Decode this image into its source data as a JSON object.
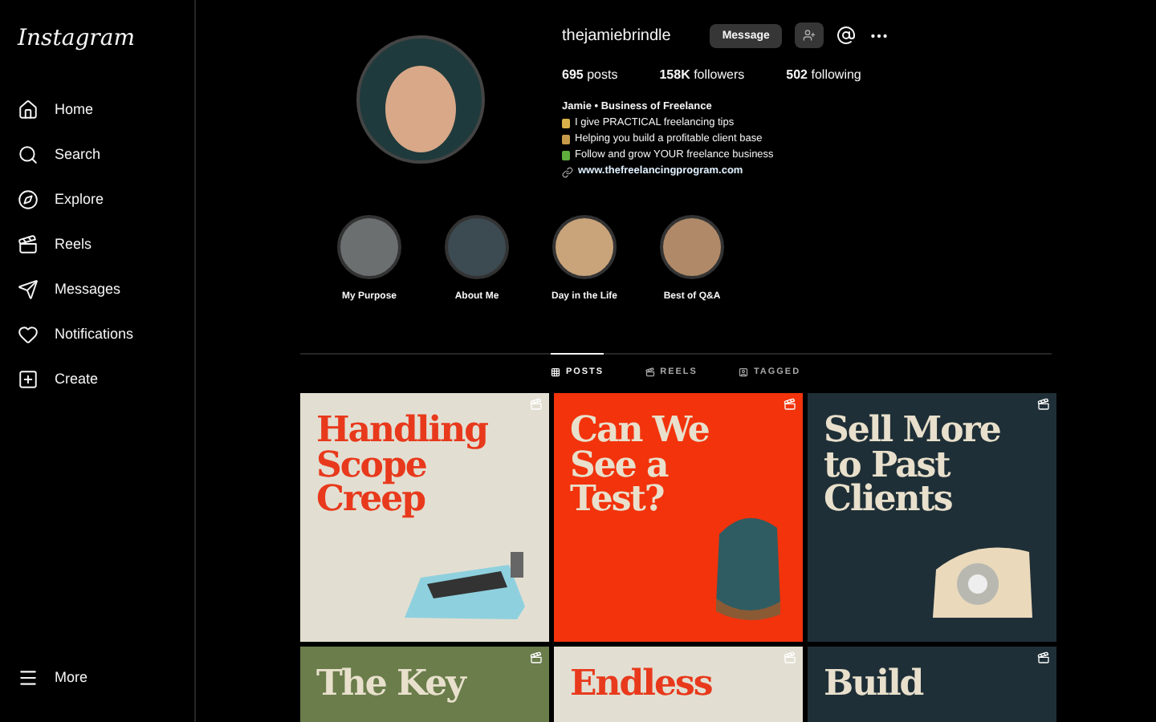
{
  "sidebar": {
    "logo": "Instagram",
    "items": [
      {
        "label": "Home"
      },
      {
        "label": "Search"
      },
      {
        "label": "Explore"
      },
      {
        "label": "Reels"
      },
      {
        "label": "Messages"
      },
      {
        "label": "Notifications"
      },
      {
        "label": "Create"
      }
    ],
    "more": "More"
  },
  "profile": {
    "username": "thejamiebrindle",
    "message_button": "Message",
    "stats": [
      {
        "value": "695",
        "label": "posts"
      },
      {
        "value": "158K",
        "label": "followers"
      },
      {
        "value": "502",
        "label": "following"
      }
    ],
    "bio_name": "Jamie • Business of Freelance",
    "bio_lines": [
      {
        "text": "I give PRACTICAL freelancing tips",
        "color": "#d9b04a"
      },
      {
        "text": "Helping you build a profitable client base",
        "color": "#c79a4a"
      },
      {
        "text": "Follow and grow YOUR freelance business",
        "color": "#5fae3c"
      }
    ],
    "link": "www.thefreelancingprogram.com"
  },
  "highlights": [
    {
      "label": "My Purpose",
      "color": "#6b6f70"
    },
    {
      "label": "About Me",
      "color": "#3c4a52"
    },
    {
      "label": "Day in the Life",
      "color": "#c9a37a"
    },
    {
      "label": "Best of Q&A",
      "color": "#b08a68"
    }
  ],
  "tabs": [
    {
      "label": "POSTS",
      "selected": true
    },
    {
      "label": "REELS",
      "selected": false
    },
    {
      "label": "TAGGED",
      "selected": false
    }
  ],
  "posts": [
    {
      "title": [
        "Handling",
        "Scope",
        "Creep"
      ],
      "color": "#e2dfd2",
      "kind": "typewriter"
    },
    {
      "title": [
        "Can We",
        "See a",
        "Test?"
      ],
      "color": "#f2330c",
      "kind": "backpack"
    },
    {
      "title": [
        "Sell More",
        "to Past",
        "Clients"
      ],
      "color": "#1f2f37",
      "kind": "telephone"
    },
    {
      "title": [
        "The Key"
      ],
      "color": "#6a7d4b",
      "kind": "none"
    },
    {
      "title": [
        "Endless"
      ],
      "color": "#e2dfd2",
      "kind": "none"
    },
    {
      "title": [
        "Build"
      ],
      "color": "#1f2f37",
      "kind": "none"
    }
  ]
}
